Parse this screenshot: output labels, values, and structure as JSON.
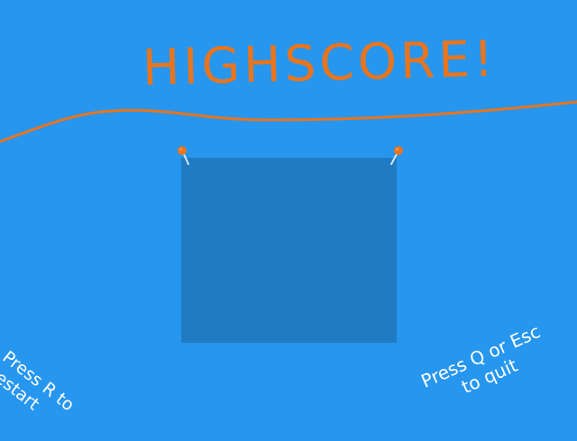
{
  "screen": {
    "title": "HIGHSCORE!",
    "restart_hint": "Press R to\nrestart",
    "quit_hint": "Press Q or Esc\nto quit"
  },
  "colors": {
    "background": "#2796ef",
    "title": "#e8751e",
    "wire": "#e8751e",
    "board": "#217bc2",
    "pin_head": "#e8751e",
    "pin_needle": "#d9e6f0",
    "hint_text": "#ffffff"
  },
  "icons": {
    "pin_left": "pushpin-icon",
    "pin_right": "pushpin-icon"
  }
}
